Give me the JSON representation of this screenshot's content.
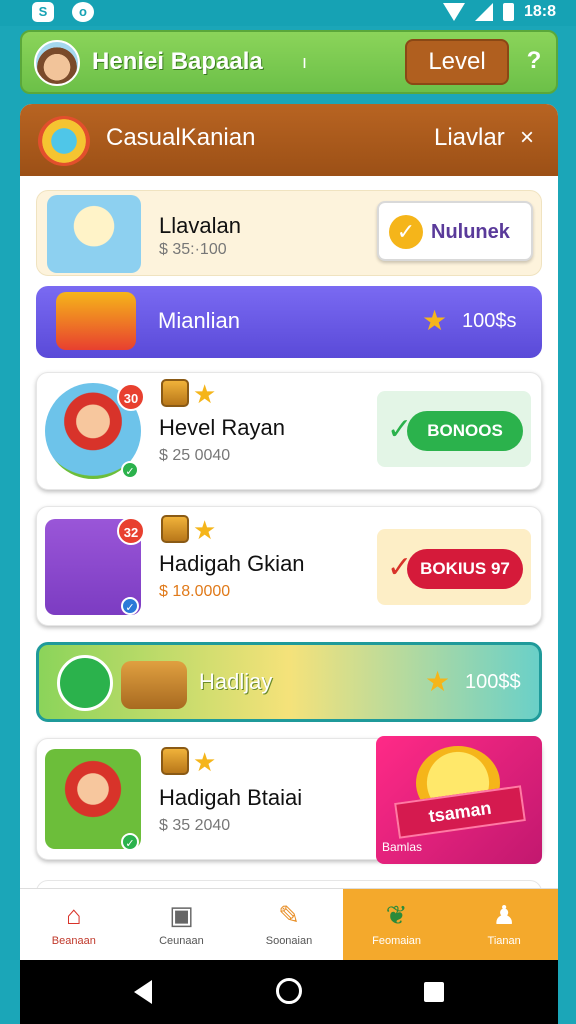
{
  "status": {
    "time": "18:8"
  },
  "topbar": {
    "player_name": "Heniei Bapaala",
    "mark": "ı",
    "level_label": "Level",
    "help": "?"
  },
  "panel": {
    "title": "CasualKanian",
    "right_label": "Liavlar",
    "close": "×"
  },
  "items": [
    {
      "title": "Llavalan",
      "amount": "$ 35:·100",
      "button": "Nulunek"
    },
    {
      "title": "Hevel Rayan",
      "amount": "$ 25 0040",
      "badge": "30",
      "button": "BONOOS"
    },
    {
      "title": "Hadigah Gkian",
      "amount": "$ 18.0000",
      "badge": "32",
      "button": "BOKIUS 97"
    },
    {
      "title": "Hadigah Btaiai",
      "amount": "$ 35 2040"
    }
  ],
  "banners": [
    {
      "label": "Mianlian",
      "value": "100$s",
      "color": "#6a5ae8"
    },
    {
      "label": "Hadljay",
      "value": "100$$",
      "color": "#8bd45a"
    }
  ],
  "promo": {
    "ribbon": "tsaman",
    "small": "Bamlas"
  },
  "nav": [
    {
      "label": "Beanaan",
      "icon": "home-icon"
    },
    {
      "label": "Ceunaan",
      "icon": "gift-icon"
    },
    {
      "label": "Soonaian",
      "icon": "task-icon"
    },
    {
      "label": "Feomaian",
      "icon": "leaf-icon"
    },
    {
      "label": "Tianan",
      "icon": "profile-icon"
    }
  ],
  "colors": {
    "accent": "#f4a92c",
    "header": "#b86422",
    "topbar": "#8bd45a"
  }
}
